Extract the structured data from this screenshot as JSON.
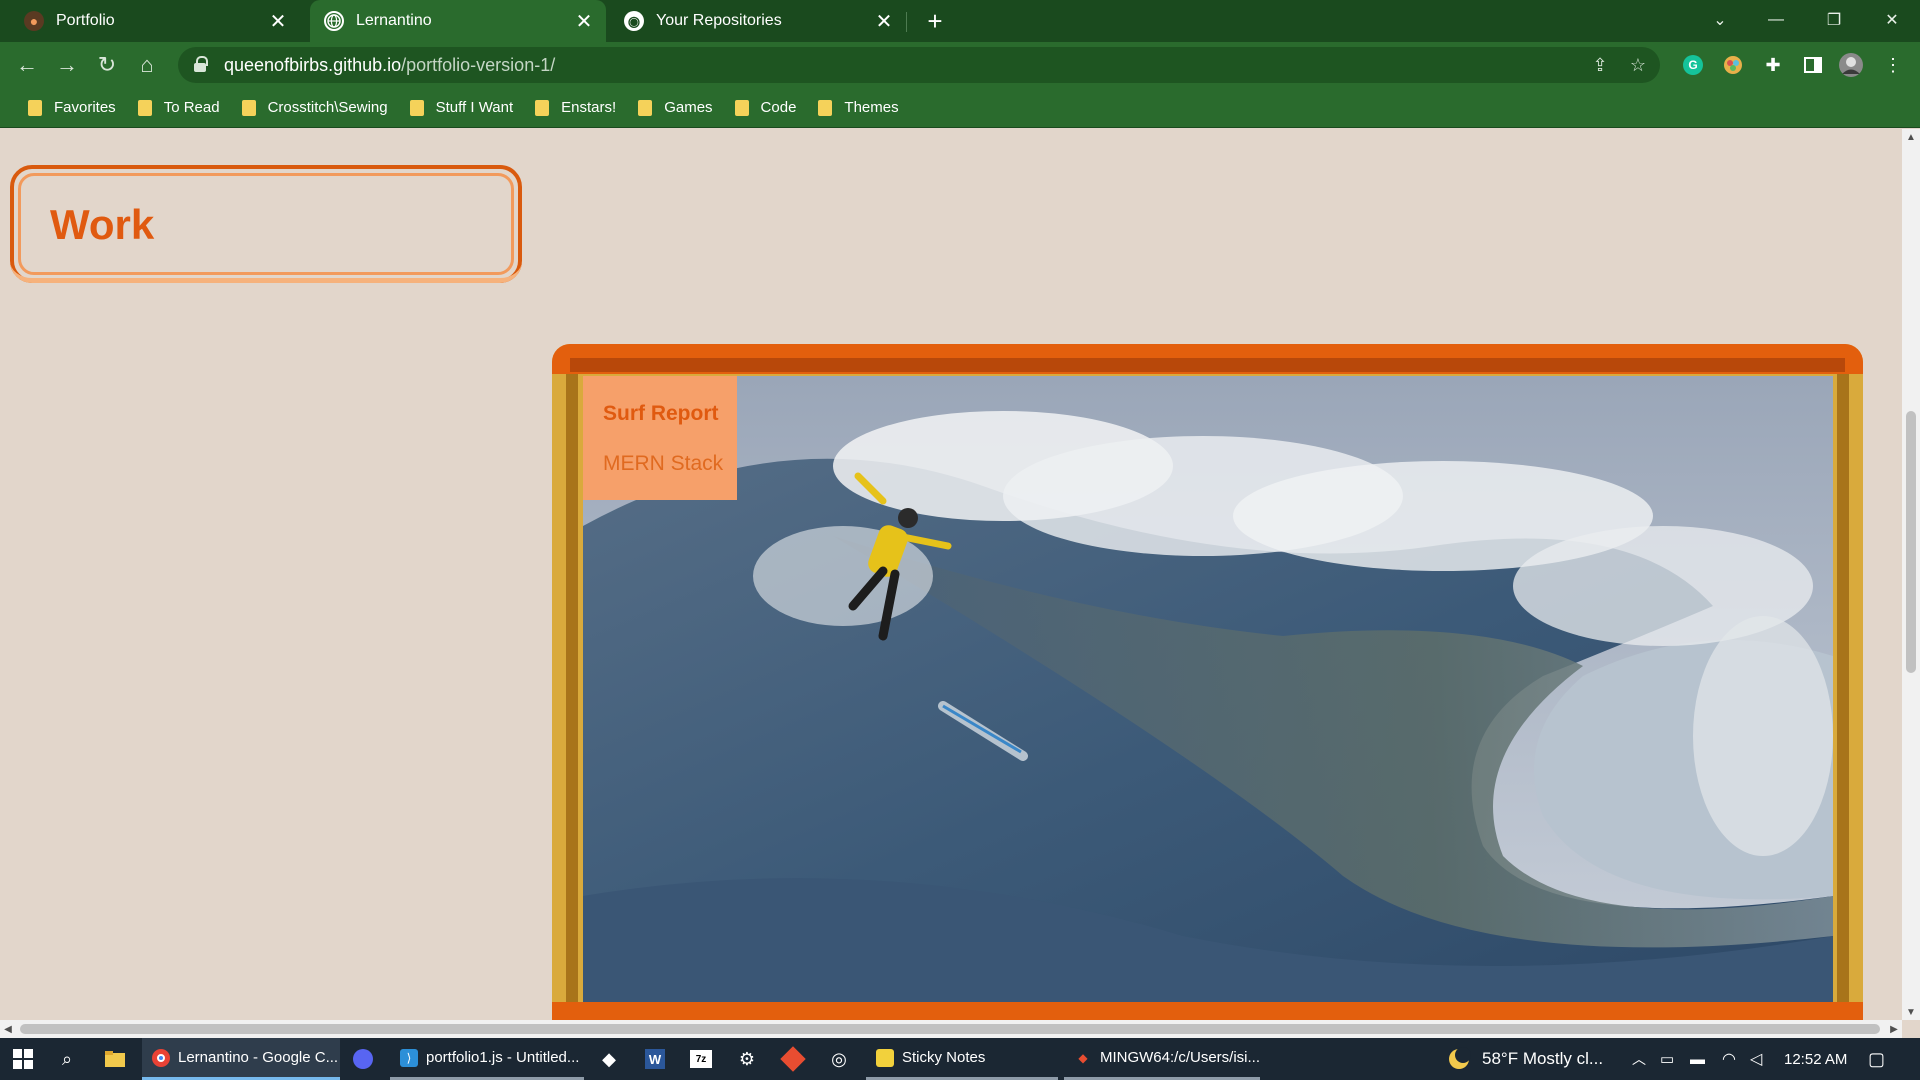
{
  "browser": {
    "tabs": [
      {
        "title": "Portfolio",
        "icon": "portfolio-favicon-icon",
        "active": false
      },
      {
        "title": "Lernantino",
        "icon": "globe-icon",
        "active": true
      },
      {
        "title": "Your Repositories",
        "icon": "github-icon",
        "active": false
      }
    ],
    "url_host": "queenofbirbs.github.io",
    "url_path": "/portfolio-version-1/",
    "bookmarks": [
      "Favorites",
      "To Read",
      "Crosstitch\\Sewing",
      "Stuff I Want",
      "Enstars!",
      "Games",
      "Code",
      "Themes"
    ]
  },
  "page": {
    "section_title": "Work",
    "project": {
      "name": "Surf Report",
      "stack": "MERN Stack"
    }
  },
  "taskbar": {
    "apps": [
      {
        "label": "Lernantino - Google C...",
        "active": true
      },
      {
        "label": "portfolio1.js - Untitled...",
        "active": false
      },
      {
        "label": "Sticky Notes",
        "active": false
      },
      {
        "label": "MINGW64:/c/Users/isi...",
        "active": false
      }
    ],
    "weather": "58°F  Mostly cl...",
    "time": "12:52 AM"
  },
  "colors": {
    "accent_orange": "#e05a10",
    "frame_gold": "#d9aa3c",
    "chrome_green": "#2a6b2d",
    "page_bg": "#e2d6cb"
  }
}
